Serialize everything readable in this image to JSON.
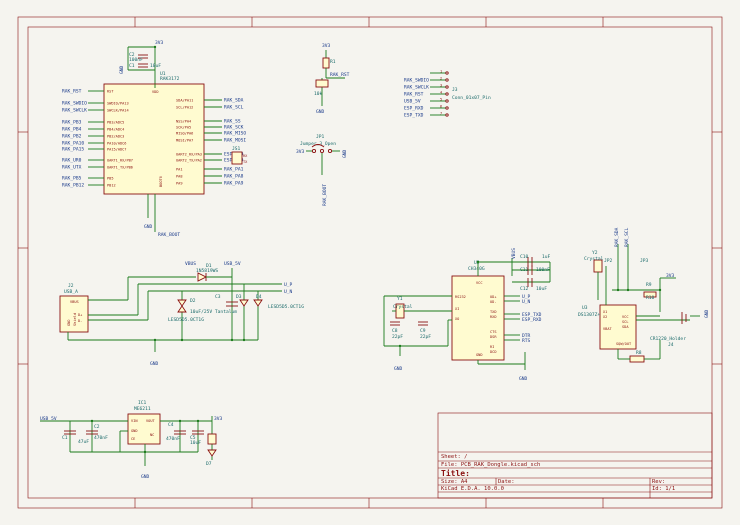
{
  "rak": {
    "ref": "U1",
    "value": "RAK3172",
    "left_labels": [
      "RAK_RST",
      "RAK_SWDIO",
      "RAK_SWCLK",
      "RAK_PB3",
      "RAK_PB4",
      "RAK_PB2",
      "RAK_PA10",
      "RAK_PA15",
      "RAK_UR0",
      "RAK_UTX",
      "RAK_PB5",
      "RAK_PB12"
    ],
    "right_labels": [
      "RAK_SDA",
      "RAK_SCL",
      "RAK_SS",
      "RAK_SCK",
      "RAK_MISO",
      "RAK_MOSI",
      "ESP_RXD",
      "ESP_TXD",
      "RAK_PA1",
      "RAK_PA8",
      "RAK_PA9"
    ],
    "pins_left": [
      "RST",
      "SWDIO/PA13",
      "SWCLK/PA14",
      "PB3/ADC5",
      "PB4/ADC4",
      "PB2/ADC3",
      "PA10/ADC6",
      "PA15/ADC7",
      "UART1_RX/PB7",
      "UART1_TX/PB6",
      "PB5",
      "PB12"
    ],
    "pins_right": [
      "SDA/PA11",
      "SCL/PA12",
      "NSS/PA4",
      "SCK/PA5",
      "MISO/PA6",
      "MOSI/PA7",
      "UART2_RX/PA3",
      "UART2_TX/PA2",
      "PA1",
      "PA8",
      "PA9"
    ],
    "top_pin": "VDD",
    "bottom_pin": "BOOT0",
    "boot_label": "RAK_BOOT",
    "gnd": "GND"
  },
  "top_cap": {
    "c1": "C2",
    "c1v": "100nF",
    "c2": "C1",
    "c2v": "10uF",
    "rail": "3V3",
    "gnd": "GND"
  },
  "header_js": {
    "ref": "JS1",
    "pins": [
      "RX",
      "TX"
    ]
  },
  "r_rst": {
    "ref": "R1",
    "value": "10k",
    "rail": "3V3",
    "net": "RAK_RST",
    "gnd": "GND"
  },
  "j3": {
    "ref": "J3",
    "value": "Conn_01x07_Pin",
    "nets": [
      "RAK_SWDIO",
      "RAK_SWCLK",
      "RAK_RST",
      "USB_5V",
      "ESP_RXD",
      "ESP_TXD"
    ],
    "pins": [
      "1",
      "2",
      "3",
      "4",
      "5",
      "6",
      "7"
    ]
  },
  "jp1": {
    "ref": "JP1",
    "value": "Jumper_3_Open",
    "left": "3V3",
    "right": "GND",
    "net": "RAK_BOOT"
  },
  "usb": {
    "ref": "J2",
    "value": "USB_A",
    "pins": [
      "VBUS",
      "D+",
      "D-",
      "GND",
      "Shield"
    ],
    "vbus": "VBUS",
    "usb5v": "USB_5V",
    "d1": "D1",
    "d1v": "1N5819WS",
    "d2": "D2",
    "d2v": "LESD5D5.0CT1G",
    "c3": "C3",
    "c3v": "10uF/25V Tantalum",
    "d3": "D3",
    "d4": "D4",
    "d4v": "LESD5D5.0CT1G",
    "up": "U_P",
    "un": "U_N",
    "gnd": "GND"
  },
  "ch340": {
    "ref": "U2",
    "value": "CH340G",
    "left": [
      "RS232",
      "XI",
      "XO"
    ],
    "right": [
      "UD+",
      "UD-",
      "TXD",
      "RXD",
      "CTS",
      "DSR",
      "RI",
      "DCD"
    ],
    "right2": [
      "R232",
      "DTR",
      "RTS"
    ],
    "bottom": [
      "GND"
    ],
    "top": [
      "VCC",
      "V3"
    ],
    "nets_r": [
      "U_P",
      "U_N",
      "ESP_TXD",
      "ESP_RXD",
      "DTR",
      "RTS"
    ],
    "y": "Y1",
    "yv": "Crystal",
    "c8": "C8",
    "c8v": "22pF",
    "c9": "C9",
    "c9v": "22pF",
    "c10": "C10",
    "c10v": "1uF",
    "c11": "C11",
    "c11v": "100nF",
    "c12": "C12",
    "c12v": "10uF",
    "vbus": "VBUS",
    "gnd": "GND"
  },
  "ds": {
    "ref": "U3",
    "value": "DS1307Z+",
    "y2": "Y2",
    "y2v": "Crystal",
    "jp2": "JP2",
    "jp3": "JP3",
    "pins_left": [
      "X1",
      "X2",
      "VBAT"
    ],
    "pins_right": [
      "VCC",
      "SCL",
      "SDA",
      "SQW/OUT"
    ],
    "net_sda": "RAK_SDA",
    "net_scl": "RAK_SCL",
    "rail": "3V3",
    "r10": "R10",
    "r8": "R8",
    "bat": "CR1220_Holder",
    "bat_ref": "J4",
    "r9": "R9",
    "gnd": "GND"
  },
  "ldo": {
    "ref": "IC1",
    "value": "ME6211",
    "pins": [
      "VIN",
      "VOUT",
      "GND",
      "CE",
      "NC"
    ],
    "in": "USB_5V",
    "out": "3V3",
    "c1": "C1",
    "c1v": "47uF",
    "c2": "C2",
    "c2v": "470nF",
    "c4": "C4",
    "c4v": "470nF",
    "c5": "C5",
    "c5v": "10uF",
    "led": "D7",
    "gnd": "GND"
  },
  "title": {
    "sheet": "Sheet: /",
    "file": "File: PCB_RAK_Dongle.kicad_sch",
    "title": "Title:",
    "size": "Size: A4",
    "date": "Date:",
    "rev": "Rev:",
    "kicad": "KiCad E.D.A. 10.0.0",
    "id": "Id: 1/1"
  }
}
